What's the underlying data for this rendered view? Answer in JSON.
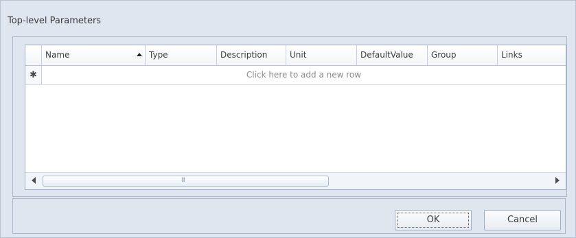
{
  "dialog": {
    "title": "Top-level Parameters"
  },
  "grid": {
    "columns": [
      {
        "label": "Name",
        "sorted": "ascending"
      },
      {
        "label": "Type"
      },
      {
        "label": "Description"
      },
      {
        "label": "Unit"
      },
      {
        "label": "DefaultValue"
      },
      {
        "label": "Group"
      },
      {
        "label": "Links"
      }
    ],
    "new_row_indicator": "✱",
    "new_row_hint": "Click here to add a new row",
    "scroll_grip": "III"
  },
  "buttons": {
    "ok": "OK",
    "cancel": "Cancel"
  }
}
